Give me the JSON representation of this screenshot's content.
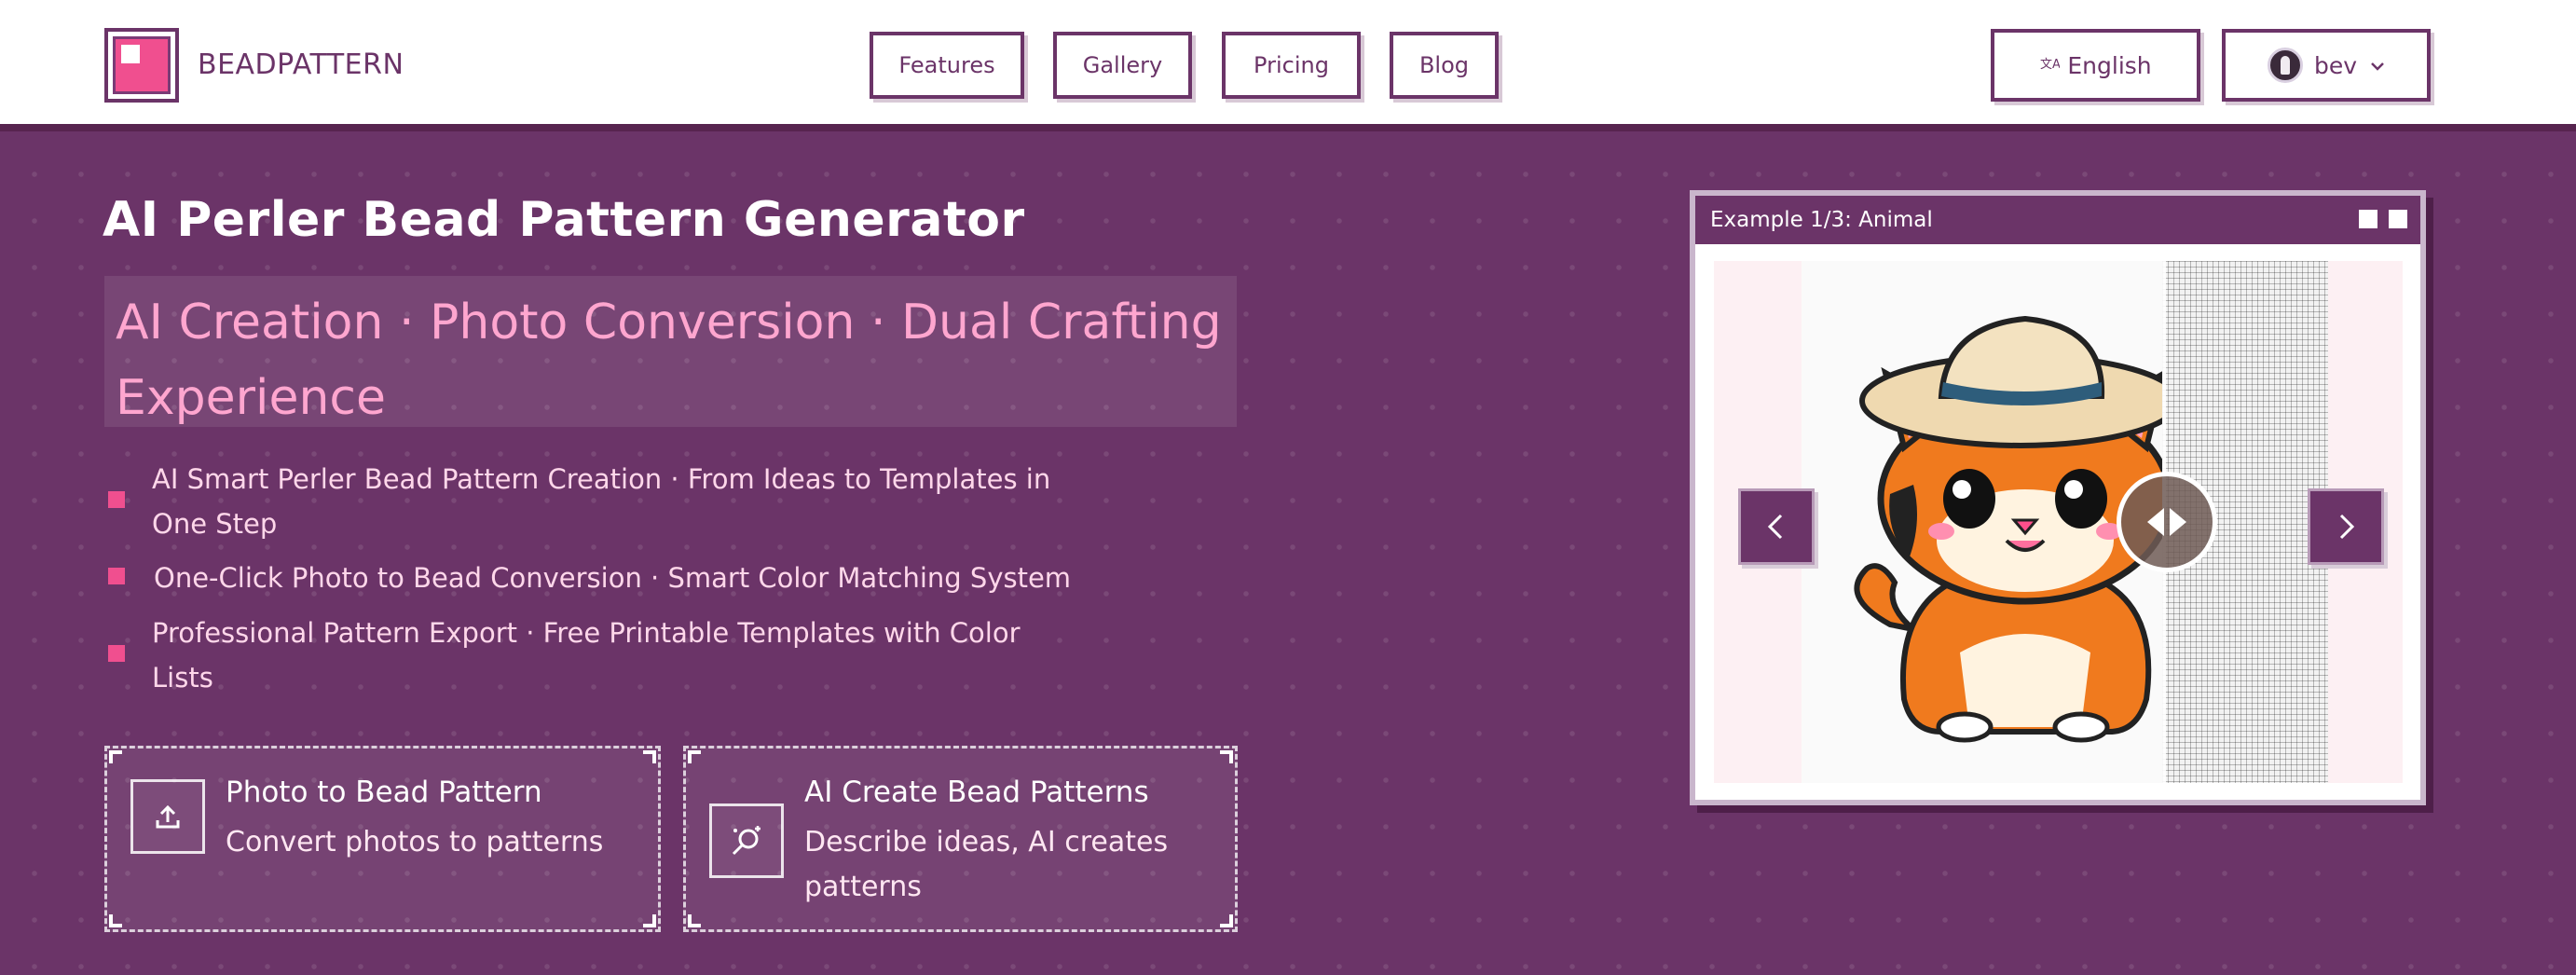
{
  "header": {
    "brand": "BEADPATTERN",
    "nav": [
      "Features",
      "Gallery",
      "Pricing",
      "Blog"
    ],
    "language": "English",
    "username": "bev"
  },
  "hero": {
    "title": "AI Perler Bead Pattern Generator",
    "subtitle": "AI Creation · Photo Conversion · Dual Crafting Experience",
    "features": [
      "AI Smart Perler Bead Pattern Creation · From Ideas to Templates in One Step",
      "One-Click Photo to Bead Conversion · Smart Color Matching System",
      "Professional Pattern Export · Free Printable Templates with Color Lists"
    ],
    "cards": [
      {
        "title": "Photo to Bead Pattern",
        "desc": "Convert photos to patterns",
        "icon": "upload-icon"
      },
      {
        "title": "AI Create Bead Patterns",
        "desc": "Describe ideas, AI creates patterns",
        "icon": "magic-wand-icon"
      }
    ]
  },
  "example": {
    "title": "Example 1/3: Animal",
    "prev_label": "‹",
    "next_label": "›"
  },
  "colors": {
    "background": "#6b3468",
    "accent_pink": "#f04f8f",
    "subtitle_pink": "#ffa6cf",
    "header_bg": "#ffffff"
  }
}
